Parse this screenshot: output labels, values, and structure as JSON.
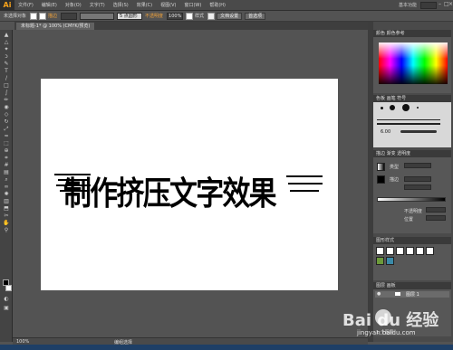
{
  "titlebar": {
    "logo": "Ai",
    "menus": [
      "文件(F)",
      "编辑(E)",
      "对象(O)",
      "文字(T)",
      "选择(S)",
      "效果(C)",
      "视图(V)",
      "窗口(W)",
      "帮助(H)"
    ],
    "workspace": "基本功能"
  },
  "controlbar": {
    "selection": "未选择对象",
    "stroke_label": "描边",
    "point_select": "5 点圆形",
    "opacity_label": "不透明度",
    "opacity_value": "100%",
    "style_label": "样式",
    "doc_settings": "文档设置",
    "preferences": "首选项"
  },
  "document": {
    "tab_label": "未标题-1* @ 100% (CMYK/预览)"
  },
  "artwork": {
    "text": "制作挤压文字效果"
  },
  "panels": {
    "color_header": "颜色 颜色参考",
    "brush_header": "色板 画笔 符号",
    "brush_size_label": "6.00",
    "stroke_header": "描边 渐变 透明度",
    "gradient_type_label": "类型",
    "gradient_angle_label": "描边",
    "opacity_label": "不透明度",
    "position_label": "位置",
    "graphic_styles_header": "图形样式",
    "layers_header": "图层 画板",
    "layer_name": "图层 1",
    "layers_count": "1 个图层"
  },
  "statusbar": {
    "zoom": "100%",
    "tool_name": "编组选择"
  },
  "watermark": {
    "main": "Bai du 经验",
    "sub": "jingyan.baidu.com"
  },
  "colors": {
    "ui_bg": "#535353",
    "accent": "#f6a21b",
    "artboard": "#ffffff",
    "taskbar": "#1e3f66"
  }
}
